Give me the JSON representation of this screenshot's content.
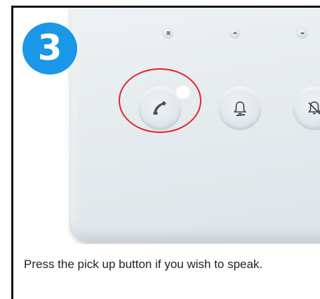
{
  "step": {
    "number": "3",
    "color": "#1a97e6"
  },
  "panel": {
    "small_buttons": [
      {
        "icon": "menu-icon"
      },
      {
        "icon": "chevron-up-icon"
      },
      {
        "icon": "chevron-down-icon"
      }
    ],
    "big_buttons": [
      {
        "icon": "phone-handset-icon",
        "highlighted": true
      },
      {
        "icon": "bell-icon",
        "highlighted": false
      },
      {
        "icon": "bell-off-icon",
        "highlighted": false
      }
    ],
    "highlight_color": "#e0262a"
  },
  "caption": {
    "text": "Press the pick up button if you wish to speak."
  }
}
